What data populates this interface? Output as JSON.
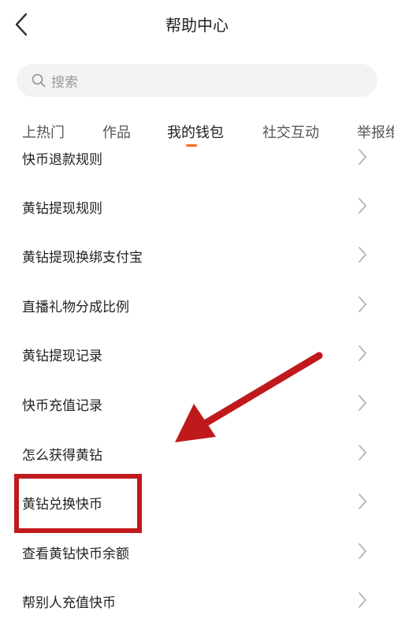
{
  "header": {
    "title": "帮助中心"
  },
  "search": {
    "placeholder": "搜索"
  },
  "tabs": [
    {
      "label": "上热门"
    },
    {
      "label": "作品"
    },
    {
      "label": "我的钱包",
      "active": true
    },
    {
      "label": "社交互动"
    },
    {
      "label": "举报维"
    }
  ],
  "list": [
    {
      "label": "快币退款规则"
    },
    {
      "label": "黄钻提现规则"
    },
    {
      "label": "黄钻提现换绑支付宝"
    },
    {
      "label": "直播礼物分成比例"
    },
    {
      "label": "黄钻提现记录"
    },
    {
      "label": "快币充值记录"
    },
    {
      "label": "怎么获得黄钻"
    },
    {
      "label": "黄钻兑换快币"
    },
    {
      "label": "查看黄钻快币余额"
    },
    {
      "label": "帮别人充值快币"
    }
  ],
  "annotation": {
    "highlight_color": "#c0191c",
    "accent_color": "#ff6a1a"
  }
}
